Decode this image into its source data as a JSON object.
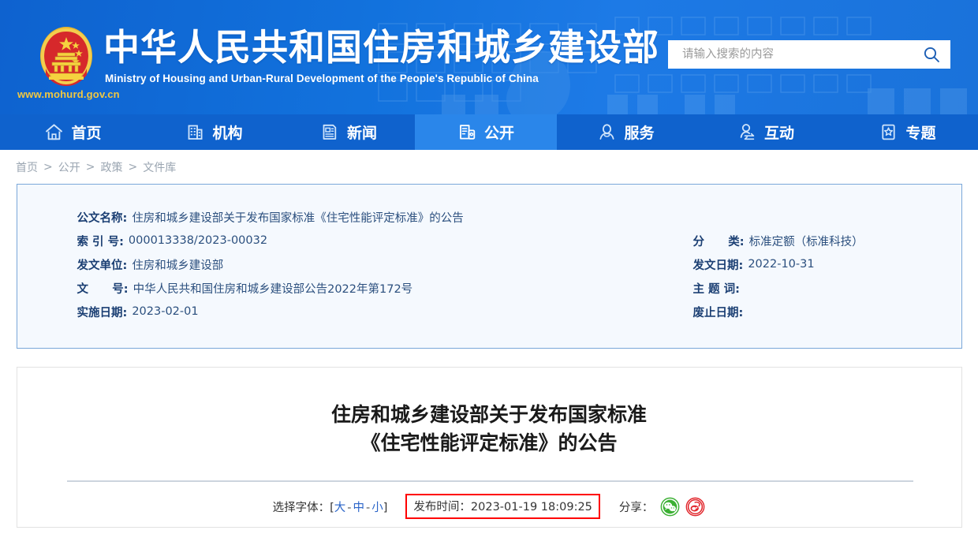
{
  "header": {
    "emblem_icon": "china-national-emblem",
    "site_url": "www.mohurd.gov.cn",
    "title_cn": "中华人民共和国住房和城乡建设部",
    "title_en": "Ministry of Housing and Urban-Rural Development of the People's Republic of China",
    "search": {
      "placeholder": "请输入搜索的内容",
      "value": "",
      "button_icon": "search-icon"
    },
    "background_color": "#1272dd"
  },
  "nav": {
    "active_index": 3,
    "background_color": "#0f62cd",
    "active_background_color": "#2a86ea",
    "items": [
      {
        "label": "首页",
        "icon": "home-icon"
      },
      {
        "label": "机构",
        "icon": "building-icon"
      },
      {
        "label": "新闻",
        "icon": "news-icon"
      },
      {
        "label": "公开",
        "icon": "open-document-icon"
      },
      {
        "label": "服务",
        "icon": "person-service-icon"
      },
      {
        "label": "互动",
        "icon": "interaction-icon"
      },
      {
        "label": "专题",
        "icon": "star-topic-icon"
      }
    ]
  },
  "breadcrumb": {
    "separator": ">",
    "items": [
      "首页",
      "公开",
      "政策",
      "文件库"
    ]
  },
  "info_card": {
    "border_color": "#7aa7d9",
    "background_color": "#f5f9fe",
    "left_rows": [
      {
        "label": "公文名称:",
        "value": "住房和城乡建设部关于发布国家标准《住宅性能评定标准》的公告"
      },
      {
        "label": "索 引 号:",
        "value": "000013338/2023-00032"
      },
      {
        "label": "发文单位:",
        "value": "住房和城乡建设部"
      },
      {
        "label": "文      号:",
        "value": "中华人民共和国住房和城乡建设部公告2022年第172号"
      },
      {
        "label": "实施日期:",
        "value": "2023-02-01"
      }
    ],
    "right_rows": [
      {
        "label": "分      类:",
        "value": "标准定额（标准科技）"
      },
      {
        "label": "发文日期:",
        "value": "2022-10-31"
      },
      {
        "label": "主 题 词:",
        "value": ""
      },
      {
        "label": "废止日期:",
        "value": ""
      }
    ]
  },
  "article": {
    "title_line1": "住房和城乡建设部关于发布国家标准",
    "title_line2": "《住宅性能评定标准》的公告",
    "tools": {
      "font_label": "选择字体：",
      "bracket_open": "[",
      "bracket_close": "]",
      "dash": "-",
      "font_sizes": [
        "大",
        "中",
        "小"
      ],
      "publish_time": "发布时间：2023-01-19 18:09:25",
      "publish_time_highlight_color": "#ff0000",
      "share_label": "分享：",
      "share_icons": [
        {
          "name": "wechat-share-icon",
          "color": "#3cb034"
        },
        {
          "name": "weibo-share-icon",
          "color": "#e1252b"
        }
      ]
    }
  }
}
